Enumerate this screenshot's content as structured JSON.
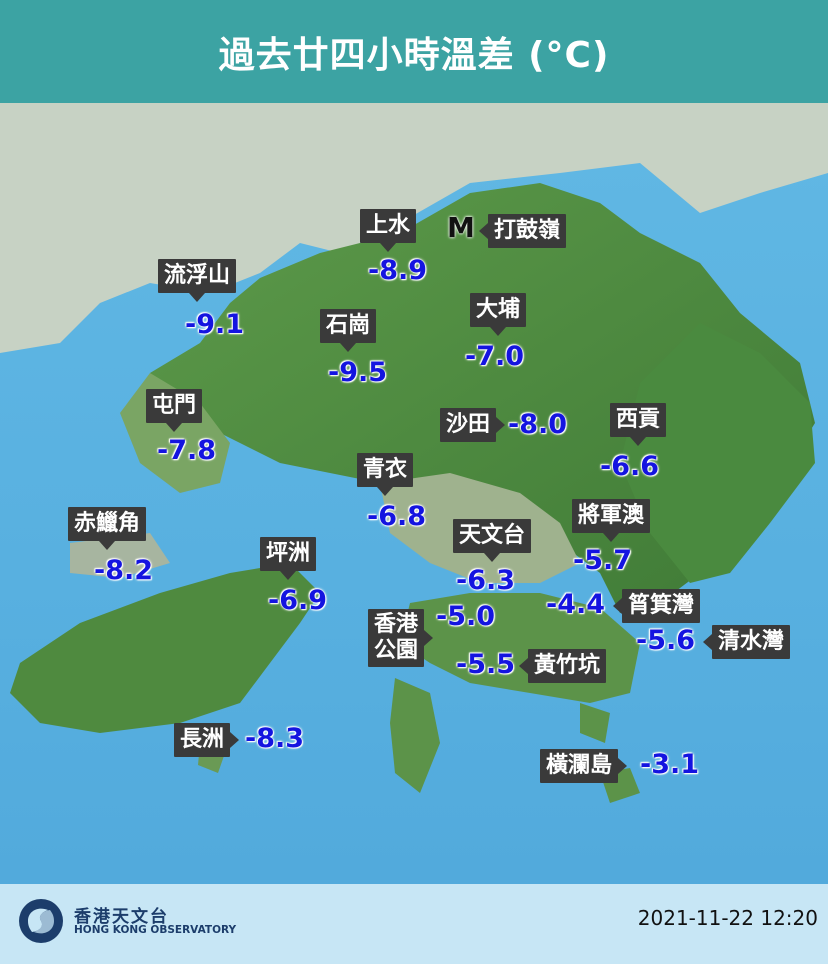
{
  "header": {
    "title": "過去廿四小時溫差 (°C)"
  },
  "footer": {
    "logo_cn": "香港天文台",
    "logo_en": "HONG KONG OBSERVATORY",
    "timestamp": "2021-11-22 12:20"
  },
  "marker": {
    "label": "M"
  },
  "stations": [
    {
      "id": "sheung-shui",
      "name": "上水",
      "value": "-8.9"
    },
    {
      "id": "tai-mo-shan",
      "name": "打鼓嶺",
      "value": ""
    },
    {
      "id": "lau-fau-shan",
      "name": "流浮山",
      "value": "-9.1"
    },
    {
      "id": "shek-kong",
      "name": "石崗",
      "value": "-9.5"
    },
    {
      "id": "tai-po",
      "name": "大埔",
      "value": "-7.0"
    },
    {
      "id": "tuen-mun",
      "name": "屯門",
      "value": "-7.8"
    },
    {
      "id": "sha-tin",
      "name": "沙田",
      "value": "-8.0"
    },
    {
      "id": "sai-kung",
      "name": "西貢",
      "value": "-6.6"
    },
    {
      "id": "tsing-yi",
      "name": "青衣",
      "value": "-6.8"
    },
    {
      "id": "tseung-kwan-o",
      "name": "將軍澳",
      "value": "-5.7"
    },
    {
      "id": "chek-lap-kok",
      "name": "赤鱲角",
      "value": "-8.2"
    },
    {
      "id": "hko",
      "name": "天文台",
      "value": "-6.3"
    },
    {
      "id": "ping-chau",
      "name": "坪洲",
      "value": "-6.9"
    },
    {
      "id": "tseung-kwan-o-bay",
      "name": "筲箕灣",
      "value": "-4.4"
    },
    {
      "id": "hk-park",
      "name": "香港\n公園",
      "value": "-5.0"
    },
    {
      "id": "clear-water-bay",
      "name": "清水灣",
      "value": "-5.6"
    },
    {
      "id": "wong-chuk-hang",
      "name": "黃竹坑",
      "value": "-5.5"
    },
    {
      "id": "cheung-chau",
      "name": "長洲",
      "value": "-8.3"
    },
    {
      "id": "waglan",
      "name": "橫瀾島",
      "value": "-3.1"
    }
  ]
}
